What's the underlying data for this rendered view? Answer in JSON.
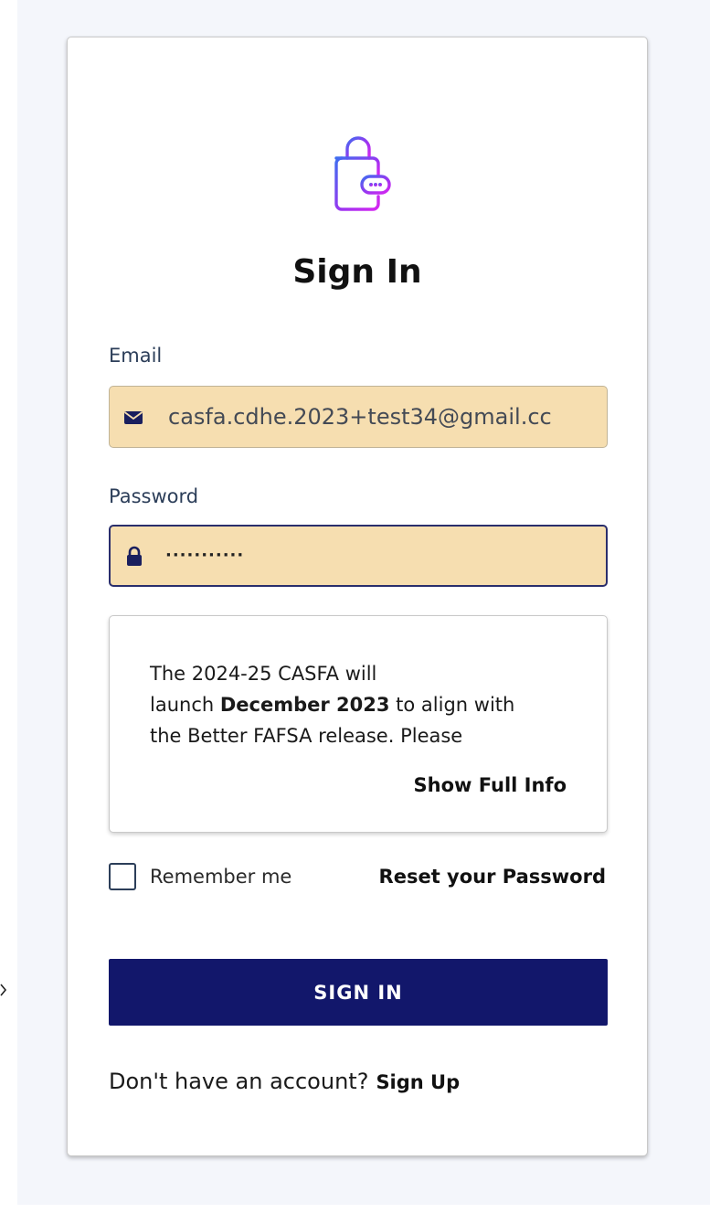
{
  "page": {
    "title": "Sign In"
  },
  "logo": {
    "icon": "wallet-lock-icon",
    "colors": [
      "#3f6df0",
      "#9b35f0",
      "#d726f0"
    ]
  },
  "form": {
    "email": {
      "label": "Email",
      "value": "casfa.cdhe.2023+test34@gmail.cc",
      "icon": "envelope-icon"
    },
    "password": {
      "label": "Password",
      "masked_value": "···········",
      "icon": "lock-icon"
    }
  },
  "info": {
    "line1": "The 2024-25 CASFA will",
    "line2_pre": "launch ",
    "line2_bold": "December 2023",
    "line2_post": " to align with",
    "line3": "the Better FAFSA release. Please",
    "show_full_label": "Show Full Info"
  },
  "options": {
    "remember_label": "Remember me",
    "remember_checked": false,
    "reset_label": "Reset your Password"
  },
  "actions": {
    "signin_label": "SIGN IN"
  },
  "footer": {
    "prompt": "Don't have an account?",
    "signup_label": "Sign Up"
  },
  "colors": {
    "primary_button": "#12176b",
    "input_fill": "#f6deb0",
    "page_background": "#f4f6fb"
  }
}
